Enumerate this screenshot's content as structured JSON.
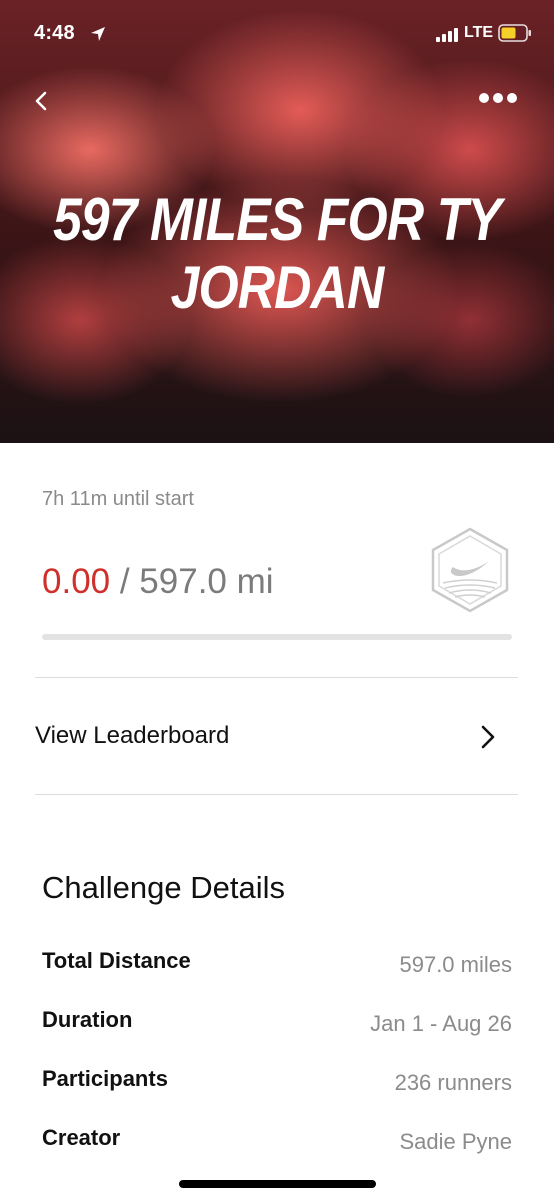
{
  "status_bar": {
    "time": "4:48",
    "network": "LTE",
    "battery_color": "#f5d02b"
  },
  "header": {
    "title": "597 MILES FOR TY JORDAN",
    "back_icon": "chevron-left-icon",
    "more_icon": "more-dots-icon"
  },
  "challenge": {
    "countdown": "7h 11m until start",
    "current_distance": "0.00",
    "goal_text": "/ 597.0 mi",
    "progress_fraction": 0,
    "badge_icon": "nike-challenge-badge-icon",
    "accent_color": "#d0302b"
  },
  "leaderboard": {
    "label": "View Leaderboard"
  },
  "details": {
    "title": "Challenge Details",
    "rows": [
      {
        "label": "Total Distance",
        "value": "597.0 miles"
      },
      {
        "label": "Duration",
        "value": "Jan 1 - Aug 26"
      },
      {
        "label": "Participants",
        "value": "236 runners"
      },
      {
        "label": "Creator",
        "value": "Sadie Pyne"
      }
    ]
  }
}
